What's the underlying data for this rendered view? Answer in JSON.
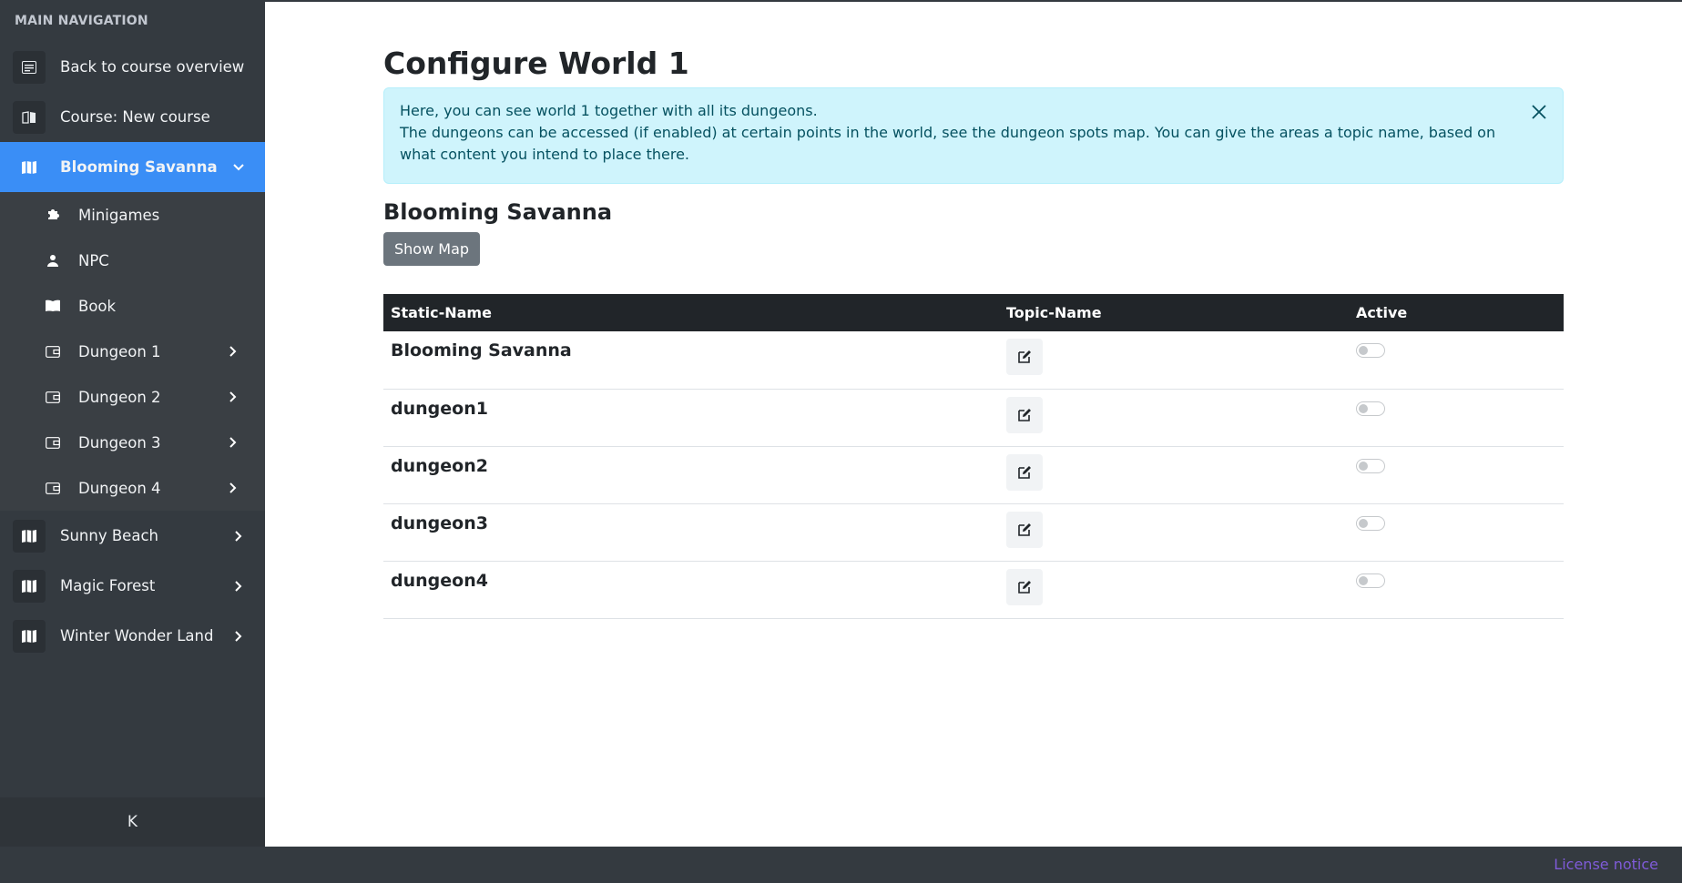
{
  "sidebar": {
    "header": "MAIN NAVIGATION",
    "items": [
      {
        "label": "Back to course overview"
      },
      {
        "label": "Course: New course"
      },
      {
        "label": "Blooming Savanna"
      }
    ],
    "sub_items": [
      {
        "label": "Minigames"
      },
      {
        "label": "NPC"
      },
      {
        "label": "Book"
      },
      {
        "label": "Dungeon 1"
      },
      {
        "label": "Dungeon 2"
      },
      {
        "label": "Dungeon 3"
      },
      {
        "label": "Dungeon 4"
      }
    ],
    "worlds": [
      {
        "label": "Sunny Beach"
      },
      {
        "label": "Magic Forest"
      },
      {
        "label": "Winter Wonder Land"
      }
    ],
    "collapse_label": "K"
  },
  "main": {
    "title": "Configure World 1",
    "alert": {
      "line1": "Here, you can see world 1 together with all its dungeons.",
      "line2": "The dungeons can be accessed (if enabled) at certain points in the world, see the dungeon spots map. You can give the areas a topic name, based on what content you intend to place there."
    },
    "section_title": "Blooming Savanna",
    "show_map_label": "Show Map",
    "table": {
      "headers": [
        "Static-Name",
        "Topic-Name",
        "Active"
      ],
      "rows": [
        {
          "static_name": "Blooming Savanna",
          "active": false
        },
        {
          "static_name": "dungeon1",
          "active": false
        },
        {
          "static_name": "dungeon2",
          "active": false
        },
        {
          "static_name": "dungeon3",
          "active": false
        },
        {
          "static_name": "dungeon4",
          "active": false
        }
      ]
    }
  },
  "footer": {
    "license_label": "License notice"
  },
  "colors": {
    "sidebar_bg": "#343a40",
    "active_item": "#3a8ef6",
    "alert_bg": "#cff4fc",
    "alert_text": "#055160",
    "table_header_bg": "#212529",
    "license_link": "#7f5bd8"
  }
}
